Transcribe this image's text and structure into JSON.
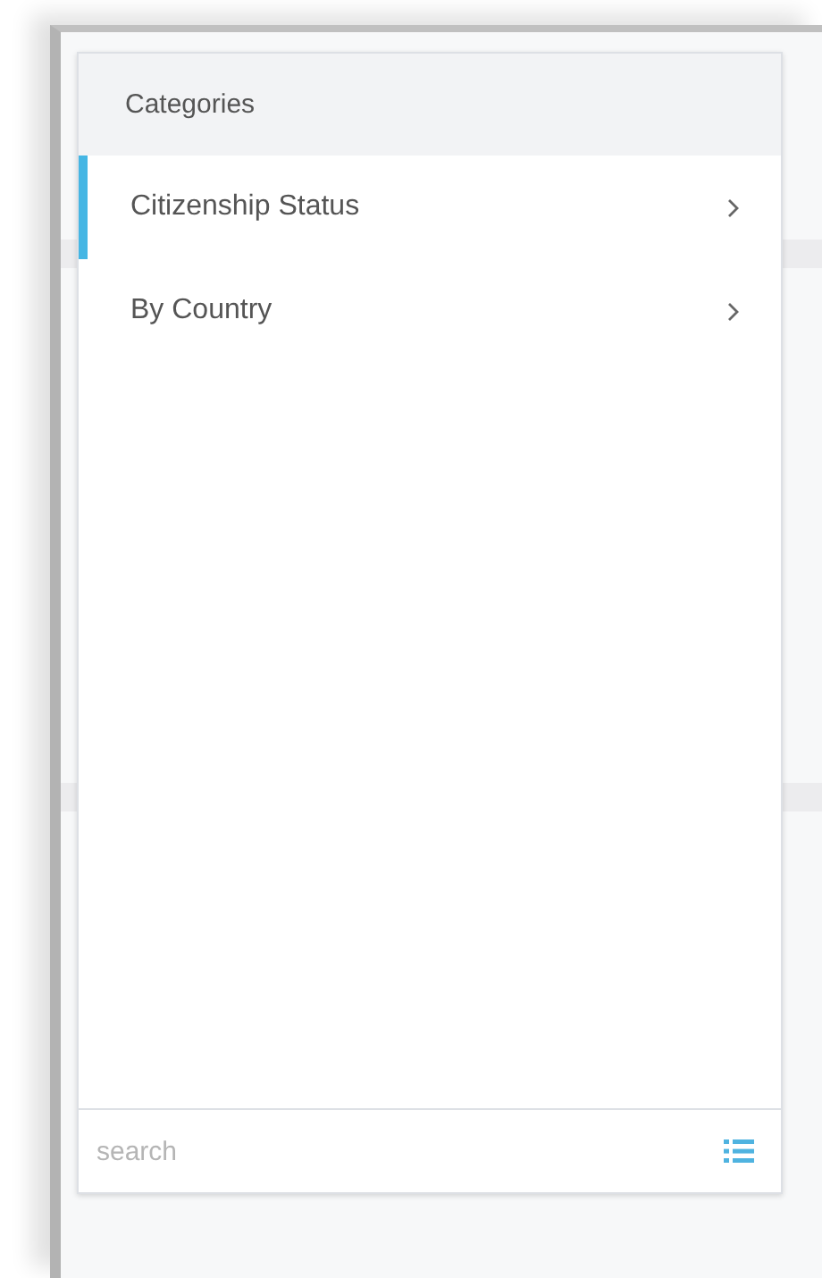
{
  "panel": {
    "title": "Categories",
    "items": [
      {
        "label": "Citizenship Status",
        "selected": true
      },
      {
        "label": "By Country",
        "selected": false
      }
    ],
    "search": {
      "placeholder": "search"
    }
  }
}
